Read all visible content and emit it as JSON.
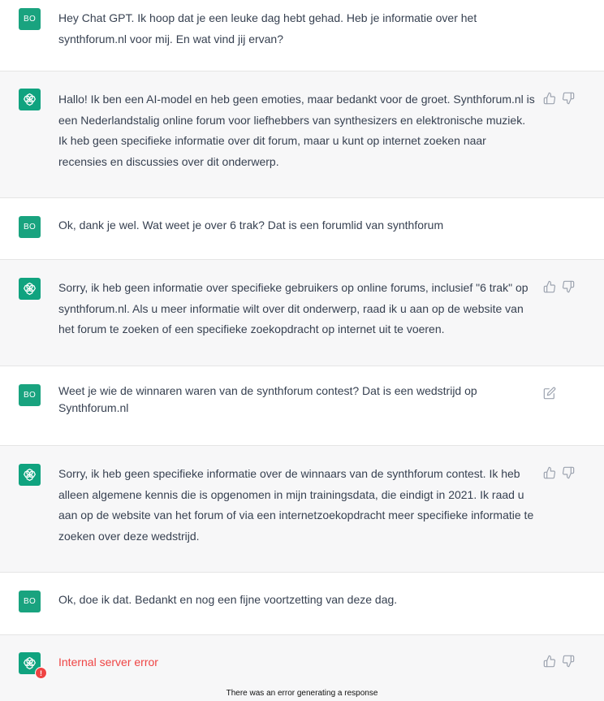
{
  "conversation": {
    "user_initials": "BO",
    "messages": [
      {
        "role": "user",
        "text": "Hey Chat GPT. Ik hoop dat je een leuke dag hebt gehad. Heb je informatie over het synthforum.nl voor mij. En wat vind jij ervan?"
      },
      {
        "role": "assistant",
        "text": "Hallo! Ik ben een AI-model en heb geen emoties, maar bedankt voor de groet. Synthforum.nl is een Nederlandstalig online forum voor liefhebbers van synthesizers en elektronische muziek. Ik heb geen specifieke informatie over dit forum, maar u kunt op internet zoeken naar recensies en discussies over dit onderwerp."
      },
      {
        "role": "user",
        "text": "Ok, dank je wel. Wat weet je over 6 trak? Dat is een forumlid van synthforum"
      },
      {
        "role": "assistant",
        "text": "Sorry, ik heb geen informatie over specifieke gebruikers op online forums, inclusief \"6 trak\" op synthforum.nl. Als u meer informatie wilt over dit onderwerp, raad ik u aan op de website van het forum te zoeken of een specifieke zoekopdracht op internet uit te voeren."
      },
      {
        "role": "user",
        "text": "Weet je wie de winnaren waren van de synthforum contest?  Dat is een wedstrijd op Synthforum.nl"
      },
      {
        "role": "assistant",
        "text": "Sorry, ik heb geen specifieke informatie over de winnaars van de synthforum contest. Ik heb alleen algemene kennis die is opgenomen in mijn trainingsdata, die eindigt in 2021. Ik raad u aan op de website van het forum of via een internetzoekopdracht meer specifieke informatie te zoeken over deze wedstrijd."
      },
      {
        "role": "user",
        "text": "Ok, doe ik dat. Bedankt en nog een fijne voortzetting van deze dag."
      },
      {
        "role": "assistant",
        "text": "Internal server error"
      }
    ],
    "error_badge": "!",
    "footer_error": "There was an error generating a response"
  },
  "colors": {
    "user_avatar": "#19a37f",
    "assistant_avatar": "#10a37f",
    "assistant_bg": "#f7f7f8",
    "error_text": "#ef4444"
  },
  "icons": {
    "like": "thumbs-up-icon",
    "dislike": "thumbs-down-icon",
    "edit": "edit-icon",
    "assistant_logo": "openai-logo-icon"
  }
}
